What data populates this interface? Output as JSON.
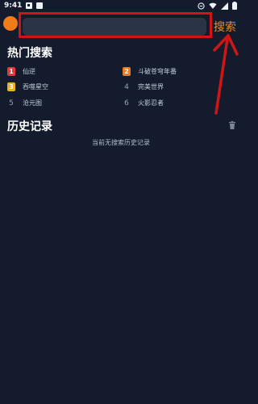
{
  "status_bar": {
    "time": "9:41"
  },
  "search": {
    "placeholder": "",
    "button_label": "搜索"
  },
  "hot_search": {
    "title": "热门搜索",
    "items": [
      {
        "rank": "1",
        "label": "仙逆",
        "rank_color": "#e8353c"
      },
      {
        "rank": "2",
        "label": "斗破苍穹年番",
        "rank_color": "#ef7a1c"
      },
      {
        "rank": "3",
        "label": "吞噬星空",
        "rank_color": "#e9b21a"
      },
      {
        "rank": "4",
        "label": "完美世界",
        "rank_color": ""
      },
      {
        "rank": "5",
        "label": "沧元图",
        "rank_color": ""
      },
      {
        "rank": "6",
        "label": "火影忍者",
        "rank_color": ""
      }
    ]
  },
  "history": {
    "title": "历史记录",
    "empty_text": "当前无搜索历史记录"
  },
  "colors": {
    "background": "#131b2c",
    "input_background": "#2b3446",
    "accent_orange": "#f08a24",
    "annotation_red": "#cf1616"
  },
  "icons": [
    "sim-icon",
    "photo-icon",
    "download-icon",
    "minus-circle-icon",
    "wifi-icon",
    "signal-icon",
    "battery-icon",
    "trash-icon",
    "arrow-annotation"
  ]
}
